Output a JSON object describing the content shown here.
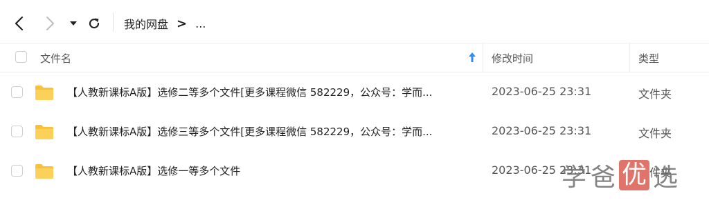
{
  "toolbar": {
    "back_icon": "chevron-left-icon",
    "forward_icon": "chevron-right-icon",
    "dropdown_icon": "caret-down-icon",
    "refresh_icon": "refresh-icon"
  },
  "breadcrumb": {
    "root": "我的网盘",
    "separator": ">",
    "more": "..."
  },
  "columns": {
    "name": "文件名",
    "time": "修改时间",
    "type": "类型",
    "sort_icon": "arrow-up-icon",
    "sort_color": "#2b8cf6"
  },
  "rows": [
    {
      "name": "【人教新课标A版】选修二等多个文件[更多课程微信 582229，公众号：学而...",
      "time": "2023-06-25 23:31",
      "type": "文件夹"
    },
    {
      "name": "【人教新课标A版】选修三等多个文件[更多课程微信 582229，公众号：学而...",
      "time": "2023-06-25 23:31",
      "type": "文件夹"
    },
    {
      "name": "【人教新课标A版】选修一等多个文件",
      "time": "2023-06-25 23:31",
      "type": "文件夹"
    }
  ],
  "folder_color": "#f9c13a",
  "watermark": {
    "char1": "学",
    "char2": "爸",
    "char3": "优",
    "char4": "选",
    "accent": "#e0736a"
  }
}
